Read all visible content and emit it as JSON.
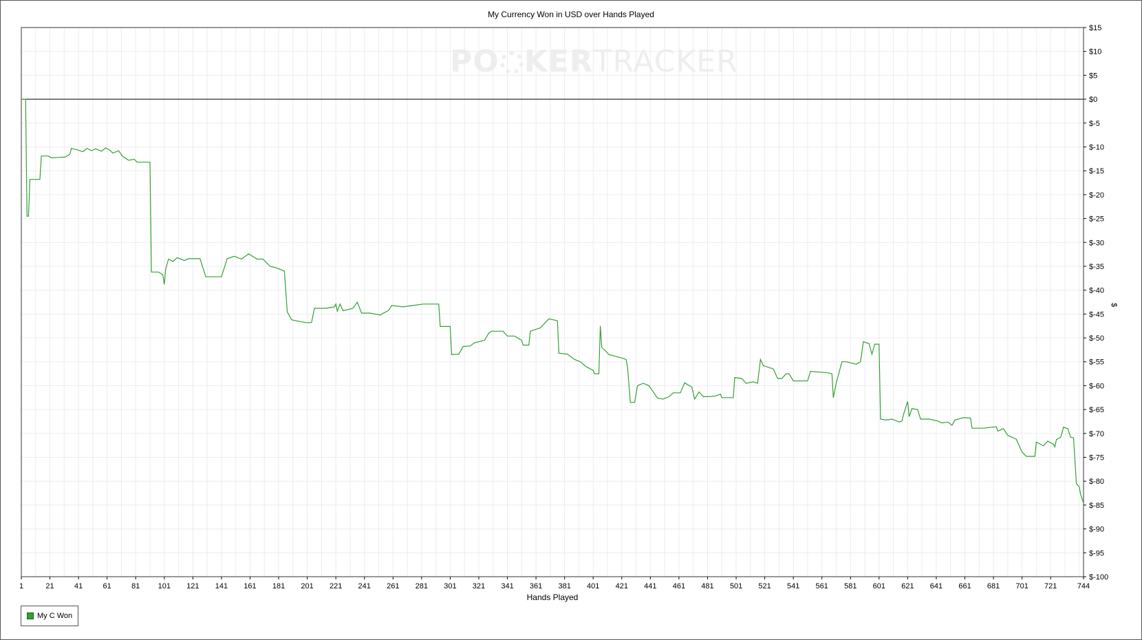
{
  "chart_data": {
    "type": "line",
    "title": "My Currency Won in USD over Hands Played",
    "xlabel": "Hands Played",
    "ylabel": "$",
    "xlim": [
      1,
      744
    ],
    "ylim": [
      -100,
      15
    ],
    "x_ticks": [
      1,
      21,
      41,
      61,
      81,
      101,
      121,
      141,
      161,
      181,
      201,
      221,
      241,
      261,
      281,
      301,
      321,
      341,
      361,
      381,
      401,
      421,
      441,
      461,
      481,
      501,
      521,
      541,
      561,
      581,
      601,
      621,
      641,
      661,
      681,
      701,
      721,
      744
    ],
    "y_ticks": [
      15,
      10,
      5,
      0,
      -5,
      -10,
      -15,
      -20,
      -25,
      -30,
      -35,
      -40,
      -45,
      -50,
      -55,
      -60,
      -65,
      -70,
      -75,
      -80,
      -85,
      -90,
      -95,
      -100
    ],
    "y_tick_labels": [
      "$15",
      "$10",
      "$5",
      "$0",
      "$-5",
      "$-10",
      "$-15",
      "$-20",
      "$-25",
      "$-30",
      "$-35",
      "$-40",
      "$-45",
      "$-50",
      "$-55",
      "$-60",
      "$-65",
      "$-70",
      "$-75",
      "$-80",
      "$-85",
      "$-90",
      "$-95",
      "$-100"
    ],
    "grid": true,
    "zero_line": true,
    "legend_position": "bottom-left",
    "series": [
      {
        "name": "My C Won",
        "color": "#33a033",
        "points": [
          [
            1,
            0
          ],
          [
            4,
            0
          ],
          [
            5,
            -24.5
          ],
          [
            6,
            -24.5
          ],
          [
            7,
            -16.8
          ],
          [
            14,
            -16.8
          ],
          [
            15,
            -11.9
          ],
          [
            20,
            -11.9
          ],
          [
            22,
            -12.3
          ],
          [
            27,
            -12.2
          ],
          [
            32,
            -12.1
          ],
          [
            35,
            -11.5
          ],
          [
            36,
            -10.3
          ],
          [
            40,
            -10.6
          ],
          [
            44,
            -11.0
          ],
          [
            47,
            -10.3
          ],
          [
            50,
            -10.8
          ],
          [
            53,
            -10.4
          ],
          [
            57,
            -10.9
          ],
          [
            60,
            -10.2
          ],
          [
            63,
            -10.7
          ],
          [
            65,
            -11.3
          ],
          [
            69,
            -10.8
          ],
          [
            72,
            -12.0
          ],
          [
            76,
            -12.8
          ],
          [
            80,
            -12.6
          ],
          [
            82,
            -13.2
          ],
          [
            91,
            -13.2
          ],
          [
            92,
            -36.2
          ],
          [
            97,
            -36.2
          ],
          [
            100,
            -36.8
          ],
          [
            101,
            -38.8
          ],
          [
            102,
            -35.5
          ],
          [
            104,
            -33.5
          ],
          [
            107,
            -34.0
          ],
          [
            110,
            -33.2
          ],
          [
            115,
            -33.8
          ],
          [
            118,
            -33.4
          ],
          [
            126,
            -33.4
          ],
          [
            130,
            -37.2
          ],
          [
            141,
            -37.2
          ],
          [
            145,
            -33.4
          ],
          [
            150,
            -32.9
          ],
          [
            155,
            -33.5
          ],
          [
            160,
            -32.4
          ],
          [
            166,
            -33.5
          ],
          [
            170,
            -33.5
          ],
          [
            175,
            -35.0
          ],
          [
            180,
            -35.4
          ],
          [
            185,
            -36.0
          ],
          [
            187,
            -44.5
          ],
          [
            190,
            -46.2
          ],
          [
            195,
            -46.5
          ],
          [
            200,
            -46.8
          ],
          [
            204,
            -46.8
          ],
          [
            206,
            -43.8
          ],
          [
            214,
            -43.8
          ],
          [
            220,
            -43.5
          ],
          [
            221,
            -42.9
          ],
          [
            222,
            -44.4
          ],
          [
            224,
            -42.9
          ],
          [
            226,
            -44.3
          ],
          [
            233,
            -43.8
          ],
          [
            236,
            -42.5
          ],
          [
            239,
            -44.8
          ],
          [
            245,
            -44.8
          ],
          [
            252,
            -45.2
          ],
          [
            258,
            -44.2
          ],
          [
            260,
            -43.2
          ],
          [
            268,
            -43.5
          ],
          [
            275,
            -43.2
          ],
          [
            282,
            -42.9
          ],
          [
            293,
            -42.9
          ],
          [
            294,
            -47.6
          ],
          [
            301,
            -47.6
          ],
          [
            302,
            -53.5
          ],
          [
            307,
            -53.4
          ],
          [
            310,
            -51.8
          ],
          [
            315,
            -51.7
          ],
          [
            318,
            -51.0
          ],
          [
            325,
            -50.5
          ],
          [
            328,
            -49.0
          ],
          [
            330,
            -48.6
          ],
          [
            338,
            -48.6
          ],
          [
            341,
            -49.6
          ],
          [
            346,
            -49.6
          ],
          [
            351,
            -50.5
          ],
          [
            352,
            -51.5
          ],
          [
            356,
            -51.5
          ],
          [
            357,
            -48.6
          ],
          [
            364,
            -47.9
          ],
          [
            370,
            -46.0
          ],
          [
            376,
            -46.4
          ],
          [
            377,
            -53.2
          ],
          [
            383,
            -53.4
          ],
          [
            388,
            -54.5
          ],
          [
            392,
            -55.0
          ],
          [
            396,
            -56.0
          ],
          [
            401,
            -56.8
          ],
          [
            402,
            -57.5
          ],
          [
            405,
            -57.5
          ],
          [
            406,
            -47.5
          ],
          [
            407,
            -52.0
          ],
          [
            410,
            -52.8
          ],
          [
            412,
            -53.5
          ],
          [
            416,
            -53.8
          ],
          [
            421,
            -54.2
          ],
          [
            424,
            -54.5
          ],
          [
            425,
            -56.0
          ],
          [
            427,
            -63.5
          ],
          [
            430,
            -63.5
          ],
          [
            432,
            -60.0
          ],
          [
            436,
            -59.5
          ],
          [
            440,
            -60.0
          ],
          [
            446,
            -62.6
          ],
          [
            450,
            -62.8
          ],
          [
            454,
            -62.3
          ],
          [
            457,
            -61.5
          ],
          [
            462,
            -61.5
          ],
          [
            465,
            -59.4
          ],
          [
            470,
            -60.3
          ],
          [
            472,
            -62.8
          ],
          [
            475,
            -61.3
          ],
          [
            478,
            -62.3
          ],
          [
            482,
            -62.3
          ],
          [
            486,
            -62.2
          ],
          [
            490,
            -61.8
          ],
          [
            491,
            -62.5
          ],
          [
            499,
            -62.5
          ],
          [
            500,
            -58.3
          ],
          [
            505,
            -58.5
          ],
          [
            508,
            -59.5
          ],
          [
            513,
            -59.2
          ],
          [
            516,
            -59.5
          ],
          [
            518,
            -54.5
          ],
          [
            520,
            -55.8
          ],
          [
            524,
            -56.2
          ],
          [
            527,
            -56.5
          ],
          [
            530,
            -58.5
          ],
          [
            533,
            -58.5
          ],
          [
            536,
            -57.5
          ],
          [
            538,
            -57.5
          ],
          [
            541,
            -59.0
          ],
          [
            551,
            -59.0
          ],
          [
            553,
            -57.0
          ],
          [
            565,
            -57.3
          ],
          [
            568,
            -57.5
          ],
          [
            569,
            -62.5
          ],
          [
            571,
            -59.5
          ],
          [
            575,
            -55.0
          ],
          [
            578,
            -55.0
          ],
          [
            585,
            -55.5
          ],
          [
            588,
            -55.0
          ],
          [
            590,
            -50.8
          ],
          [
            594,
            -51.2
          ],
          [
            596,
            -53.4
          ],
          [
            598,
            -51.3
          ],
          [
            601,
            -51.3
          ],
          [
            602,
            -67.0
          ],
          [
            606,
            -67.2
          ],
          [
            610,
            -67.0
          ],
          [
            615,
            -67.6
          ],
          [
            617,
            -67.4
          ],
          [
            618,
            -66.1
          ],
          [
            621,
            -63.3
          ],
          [
            622,
            -66.5
          ],
          [
            624,
            -64.8
          ],
          [
            628,
            -65.0
          ],
          [
            630,
            -67.0
          ],
          [
            636,
            -67.0
          ],
          [
            642,
            -67.4
          ],
          [
            645,
            -67.8
          ],
          [
            649,
            -67.6
          ],
          [
            652,
            -68.3
          ],
          [
            654,
            -67.2
          ],
          [
            660,
            -66.7
          ],
          [
            665,
            -66.8
          ],
          [
            666,
            -68.9
          ],
          [
            674,
            -68.9
          ],
          [
            683,
            -68.6
          ],
          [
            684,
            -69.5
          ],
          [
            688,
            -69.0
          ],
          [
            691,
            -70.4
          ],
          [
            697,
            -71.2
          ],
          [
            701,
            -73.9
          ],
          [
            704,
            -74.8
          ],
          [
            710,
            -74.8
          ],
          [
            711,
            -71.8
          ],
          [
            716,
            -72.6
          ],
          [
            719,
            -71.6
          ],
          [
            723,
            -72.3
          ],
          [
            724,
            -72.8
          ],
          [
            725,
            -71.3
          ],
          [
            728,
            -70.8
          ],
          [
            730,
            -68.7
          ],
          [
            733,
            -69.0
          ],
          [
            735,
            -70.8
          ],
          [
            737,
            -70.9
          ],
          [
            739,
            -80.5
          ],
          [
            741,
            -81.2
          ],
          [
            742,
            -82.8
          ],
          [
            744,
            -84.6
          ]
        ]
      }
    ]
  },
  "watermark": {
    "text_left": "PO",
    "text_mid": "KER",
    "text_right": "TRACKER"
  }
}
